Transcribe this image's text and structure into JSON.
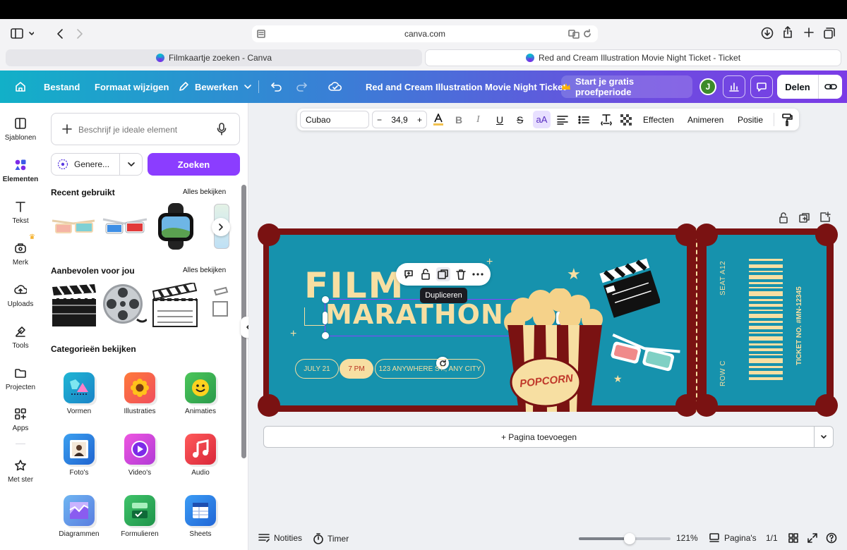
{
  "browser": {
    "url": "canva.com",
    "tabs": [
      {
        "label": "Filmkaartje zoeken - Canva"
      },
      {
        "label": "Red and Cream Illustration Movie Night Ticket - Ticket"
      }
    ]
  },
  "toolbar": {
    "file": "Bestand",
    "resize": "Formaat wijzigen",
    "edit": "Bewerken",
    "doc_title": "Red and Cream Illustration Movie Night Ticket",
    "trial": "Start je gratis proefperiode",
    "avatar": "J",
    "share": "Delen"
  },
  "rail": [
    {
      "label": "Sjablonen"
    },
    {
      "label": "Elementen"
    },
    {
      "label": "Tekst"
    },
    {
      "label": "Merk"
    },
    {
      "label": "Uploads"
    },
    {
      "label": "Tools"
    },
    {
      "label": "Projecten"
    },
    {
      "label": "Apps"
    },
    {
      "label": "Met ster"
    }
  ],
  "panel": {
    "search_placeholder": "Beschrijf je ideale element",
    "generate": "Genere...",
    "search_button": "Zoeken",
    "recent_title": "Recent gebruikt",
    "recent_link": "Alles bekijken",
    "recommended_title": "Aanbevolen voor jou",
    "recommended_link": "Alles bekijken",
    "categories_title": "Categorieën bekijken",
    "categories": [
      {
        "label": "Vormen"
      },
      {
        "label": "Illustraties"
      },
      {
        "label": "Animaties"
      },
      {
        "label": "Foto's"
      },
      {
        "label": "Video's"
      },
      {
        "label": "Audio"
      },
      {
        "label": "Diagrammen"
      },
      {
        "label": "Formulieren"
      },
      {
        "label": "Sheets"
      }
    ]
  },
  "format": {
    "font": "Cubao",
    "size": "34,9",
    "case": "aA",
    "effects": "Effecten",
    "animate": "Animeren",
    "position": "Positie"
  },
  "ticket": {
    "title1": "FILM",
    "title2": "MARATHON",
    "date": "JULY 21",
    "time": "7 PM",
    "address": "123 ANYWHERE ST., ANY CITY",
    "popcorn": "POPCORN",
    "seat": "SEAT A12",
    "row": "ROW C",
    "ticket_no": "TICKET NO. #MN-12345"
  },
  "tooltip": "Dupliceren",
  "add_page": "+ Pagina toevoegen",
  "bottom": {
    "notes": "Notities",
    "timer": "Timer",
    "zoom": "121%",
    "zoom_fraction": 0.55,
    "pages": "Pagina's",
    "page_count": "1/1"
  },
  "colors": {
    "canva_purple": "#7d2ae8",
    "ticket_teal": "#1692ad",
    "ticket_maroon": "#7a1212",
    "ticket_cream": "#f7dfa2"
  }
}
